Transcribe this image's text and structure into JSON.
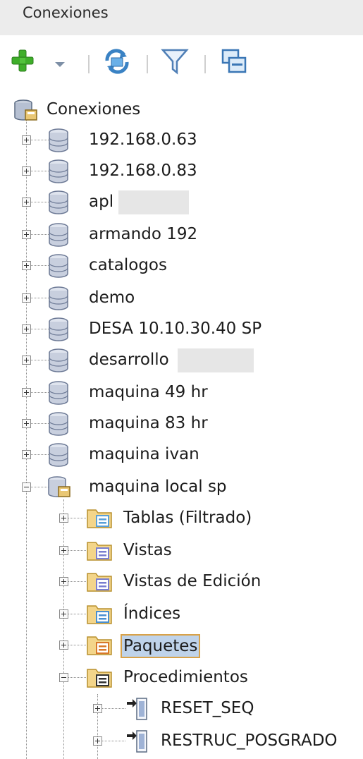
{
  "panel": {
    "title": "Conexiones"
  },
  "toolbar": {
    "buttons": [
      {
        "name": "add-connection-button",
        "icon": "plus-icon",
        "color": "#3fae2a"
      },
      {
        "name": "add-dropdown-button",
        "icon": "chevron-down-icon"
      },
      {
        "name": "refresh-button",
        "icon": "refresh-icon"
      },
      {
        "name": "filter-button",
        "icon": "filter-icon"
      },
      {
        "name": "collapse-button",
        "icon": "collapse-icon"
      }
    ]
  },
  "tree": {
    "root": {
      "label": "Conexiones",
      "icon": "connections-root-icon"
    },
    "connections": [
      {
        "label": "192.168.0.63",
        "expanded": false
      },
      {
        "label": "192.168.0.83",
        "expanded": false
      },
      {
        "label": "apl",
        "expanded": false,
        "redacted": true
      },
      {
        "label": "armando 192",
        "expanded": false
      },
      {
        "label": "catalogos",
        "expanded": false
      },
      {
        "label": "demo",
        "expanded": false
      },
      {
        "label": "DESA 10.10.30.40 SP",
        "expanded": false
      },
      {
        "label": "desarrollo",
        "expanded": false,
        "redacted": true
      },
      {
        "label": "maquina 49 hr",
        "expanded": false
      },
      {
        "label": "maquina 83 hr",
        "expanded": false
      },
      {
        "label": "maquina ivan",
        "expanded": false
      },
      {
        "label": "maquina local sp",
        "expanded": true
      }
    ],
    "local_children": [
      {
        "label": "Tablas (Filtrado)",
        "icon": "tables-folder-icon",
        "expanded": false
      },
      {
        "label": "Vistas",
        "icon": "views-folder-icon",
        "expanded": false
      },
      {
        "label": "Vistas de Edición",
        "icon": "edition-views-folder-icon",
        "expanded": false
      },
      {
        "label": "Índices",
        "icon": "indexes-folder-icon",
        "expanded": false
      },
      {
        "label": "Paquetes",
        "icon": "packages-folder-icon",
        "expanded": false,
        "selected": true
      },
      {
        "label": "Procedimientos",
        "icon": "procedures-folder-icon",
        "expanded": true
      }
    ],
    "procedures": [
      {
        "label": "RESET_SEQ",
        "icon": "procedure-icon"
      },
      {
        "label": "RESTRUC_POSGRADO",
        "icon": "procedure-icon"
      }
    ]
  }
}
